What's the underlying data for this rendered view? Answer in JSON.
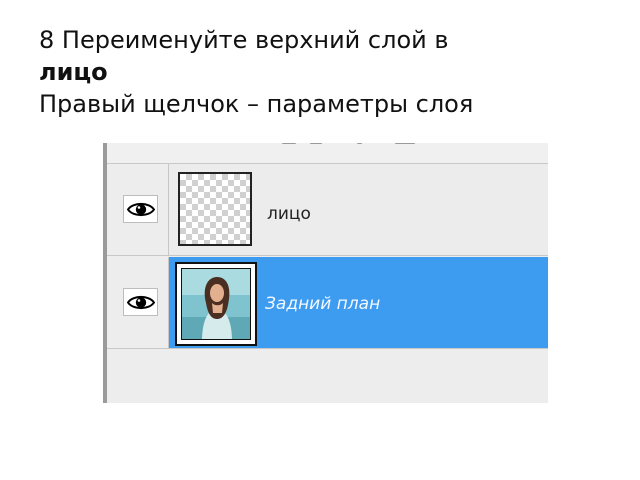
{
  "caption": {
    "line1": "8 Переименуйте верхний слой в",
    "line2_bold": "лицо",
    "line3": "Правый щелчок – параметры слоя"
  },
  "layers_panel": {
    "layers": [
      {
        "name": "лицо",
        "visible": true,
        "selected": false,
        "thumbnail": "transparent-checkerboard"
      },
      {
        "name": "Задний план",
        "visible": true,
        "selected": true,
        "thumbnail": "photo-woman"
      }
    ],
    "colors": {
      "selected_row": "#3d9bf0",
      "panel_bg": "#ededed"
    },
    "icons": [
      "eye-icon"
    ]
  }
}
